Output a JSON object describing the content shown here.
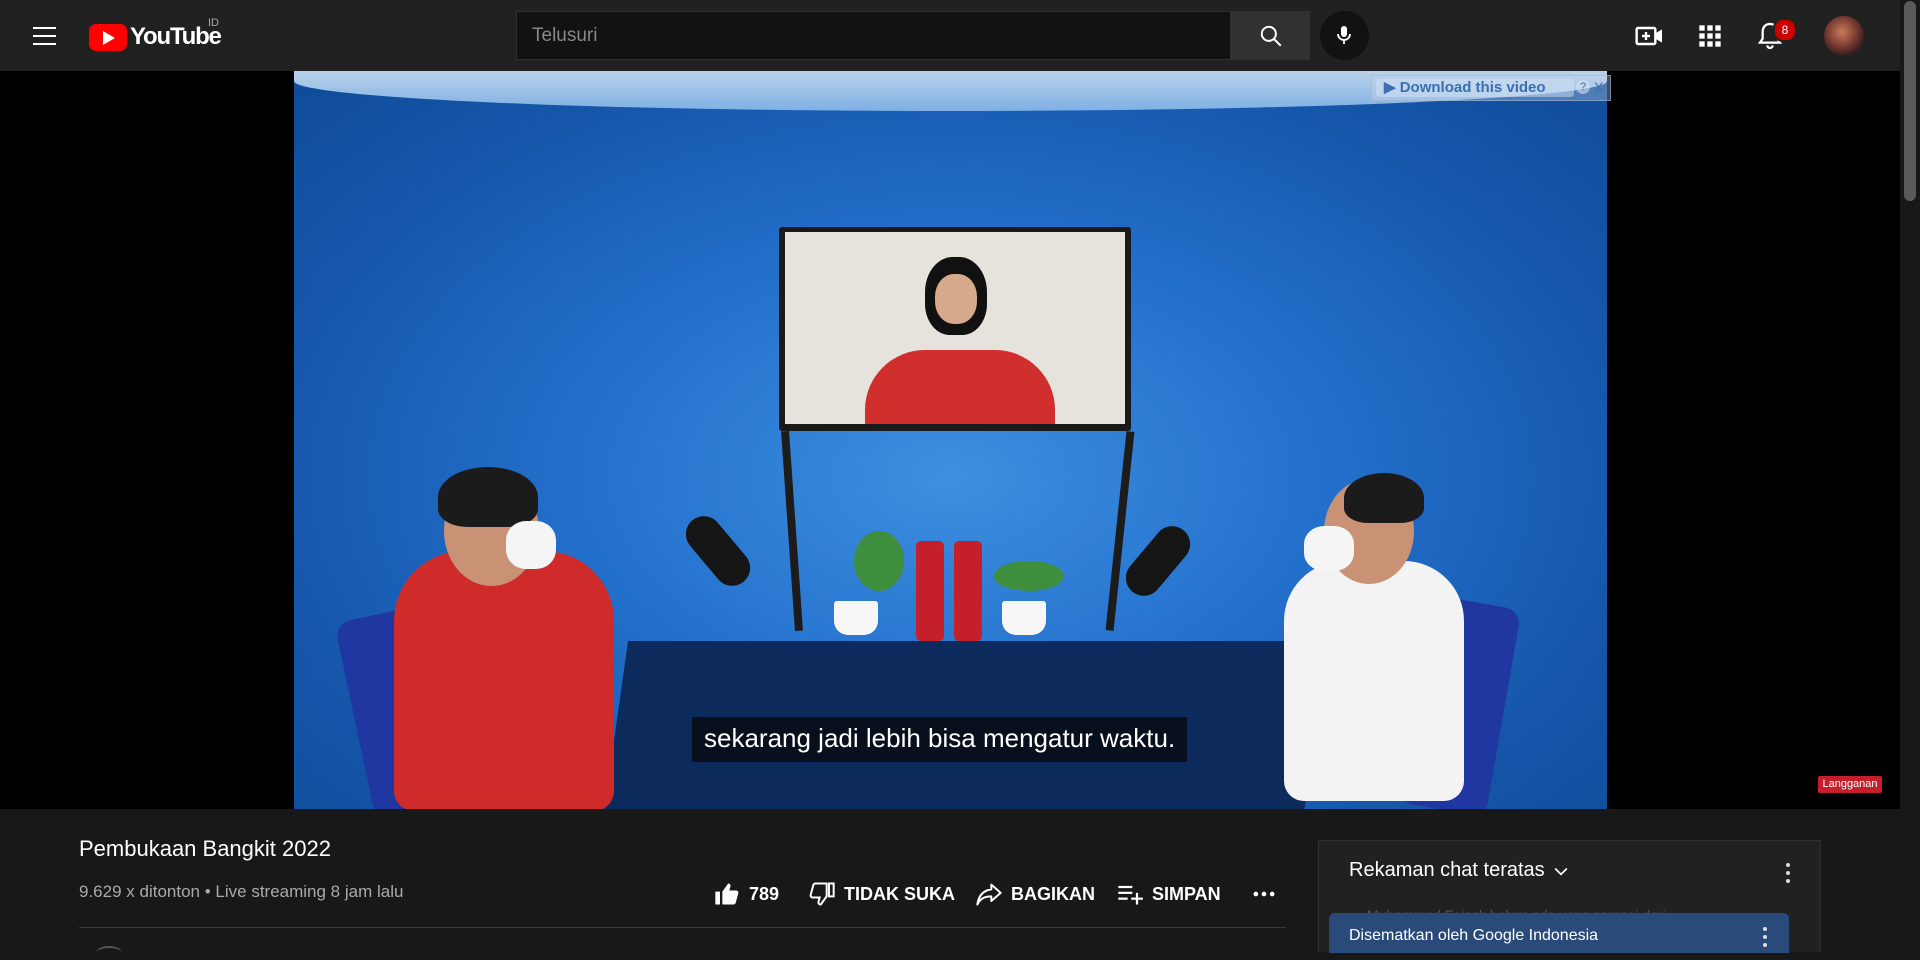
{
  "header": {
    "logo_text": "YouTube",
    "region": "ID",
    "search_placeholder": "Telusuri",
    "notification_count": "8",
    "icons": [
      "menu-icon",
      "search-icon",
      "mic-icon",
      "create-video-icon",
      "apps-icon",
      "bell-icon"
    ]
  },
  "player": {
    "subtitle": "sekarang jadi lebih bisa mengatur waktu.",
    "download_label": "▶ Download this video",
    "download_help": "?",
    "download_close": "X",
    "watermark_label": "Langganan"
  },
  "video": {
    "title": "Pembukaan Bangkit 2022",
    "views": "9.629 x ditonton",
    "separator": "•",
    "streamed": "Live streaming 8 jam lalu",
    "actions": {
      "like_count": "789",
      "dislike_label": "TIDAK SUKA",
      "share_label": "BAGIKAN",
      "save_label": "SIMPAN"
    }
  },
  "chat": {
    "header": "Rekaman chat teratas",
    "ghost_message": "Muhammad Faisal: belum ada yang sampai dari",
    "pinned_label": "Disematkan oleh Google Indonesia"
  },
  "colors": {
    "background": "#181818",
    "topbar": "#212121",
    "brand_red": "#ff0000",
    "badge_red": "#cc0000",
    "pinned_blue": "#2a4a7a"
  }
}
